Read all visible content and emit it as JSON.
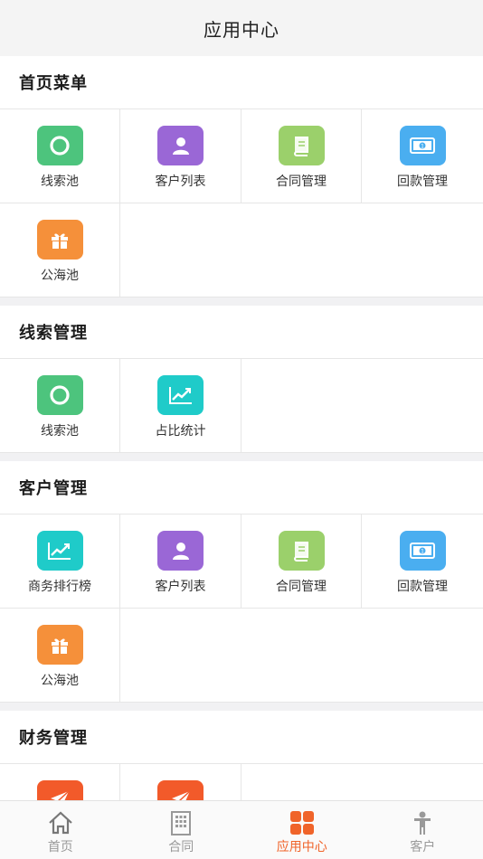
{
  "header": {
    "title": "应用中心"
  },
  "sections": [
    {
      "title": "首页菜单",
      "items": [
        {
          "label": "线索池",
          "icon": "circle-icon",
          "color": "#4dc47d"
        },
        {
          "label": "客户列表",
          "icon": "user-icon",
          "color": "#9a67d6"
        },
        {
          "label": "合同管理",
          "icon": "book-icon",
          "color": "#9bd06b"
        },
        {
          "label": "回款管理",
          "icon": "money-icon",
          "color": "#4aaef0"
        },
        {
          "label": "公海池",
          "icon": "gift-icon",
          "color": "#f5903a"
        }
      ]
    },
    {
      "title": "线索管理",
      "items": [
        {
          "label": "线索池",
          "icon": "circle-icon",
          "color": "#4dc47d"
        },
        {
          "label": "占比统计",
          "icon": "trend-chart-icon",
          "color": "#1fcbc9"
        }
      ]
    },
    {
      "title": "客户管理",
      "items": [
        {
          "label": "商务排行榜",
          "icon": "trend-chart-icon",
          "color": "#1fcbc9"
        },
        {
          "label": "客户列表",
          "icon": "user-icon",
          "color": "#9a67d6"
        },
        {
          "label": "合同管理",
          "icon": "book-icon",
          "color": "#9bd06b"
        },
        {
          "label": "回款管理",
          "icon": "money-icon",
          "color": "#4aaef0"
        },
        {
          "label": "公海池",
          "icon": "gift-icon",
          "color": "#f5903a"
        }
      ]
    },
    {
      "title": "财务管理",
      "items": [
        {
          "icon": "paper-plane-icon",
          "color": "#f25a2a"
        },
        {
          "icon": "paper-plane-icon",
          "color": "#f25a2a"
        }
      ]
    }
  ],
  "tabbar": {
    "items": [
      {
        "label": "首页",
        "icon": "home-icon",
        "active": false
      },
      {
        "label": "合同",
        "icon": "building-icon",
        "active": false
      },
      {
        "label": "应用中心",
        "icon": "apps-grid-icon",
        "active": true
      },
      {
        "label": "客户",
        "icon": "person-icon",
        "active": false
      }
    ]
  },
  "colors": {
    "accent": "#f0642a",
    "inactive": "#9a9a9a"
  }
}
